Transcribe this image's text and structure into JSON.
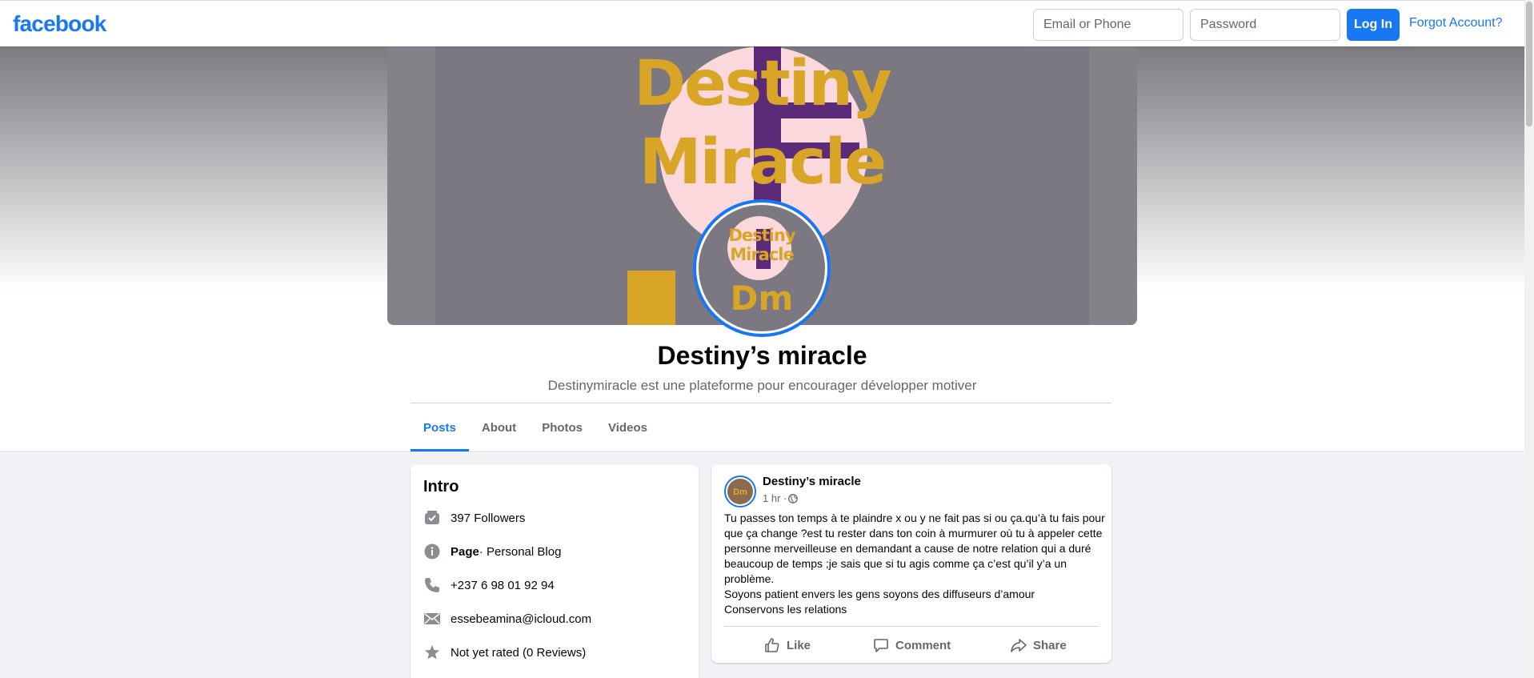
{
  "header": {
    "logo": "facebook",
    "email_placeholder": "Email or Phone",
    "password_placeholder": "Password",
    "login_label": "Log In",
    "forgot_label": "Forgot Account?"
  },
  "cover": {
    "line1": "Destiny",
    "line2": "Miracle",
    "avatar_line1": "Destiny",
    "avatar_line2": "Miracle",
    "avatar_dm": "Dm"
  },
  "page": {
    "name": "Destiny’s miracle",
    "description": "Destinymiracle est une plateforme pour encourager développer motiver"
  },
  "tabs": [
    {
      "label": "Posts",
      "active": true
    },
    {
      "label": "About"
    },
    {
      "label": "Photos"
    },
    {
      "label": "Videos"
    }
  ],
  "intro": {
    "title": "Intro",
    "followers": "397 Followers",
    "page_label": "Page",
    "page_category": " · Personal Blog",
    "phone": "+237 6 98 01 92 94",
    "email": "essebeamina@icloud.com",
    "rating": "Not yet rated (0 Reviews)"
  },
  "post": {
    "author": "Destiny’s miracle",
    "time": "1 hr · ",
    "avatar_text": "Dm",
    "text_line1": "Tu passes ton temps à te plaindre x ou y ne fait pas si ou ça.qu’à tu fais pour que ça change ?est tu rester dans ton coin à murmurer où tu à appeler cette personne merveilleuse en demandant a cause de notre relation qui a duré beaucoup de temps ;je sais que si tu agis comme ça c’est qu’il y’a un problème.",
    "text_line2": "Soyons patient envers les gens soyons des diffuseurs d’amour",
    "text_line3": "Conservons les relations",
    "like": "Like",
    "comment": "Comment",
    "share": "Share"
  },
  "colors": {
    "brand": "#1877f2",
    "background": "#f0f2f5",
    "cover_gold": "#d8a526",
    "cover_purple": "#5b2a78"
  }
}
